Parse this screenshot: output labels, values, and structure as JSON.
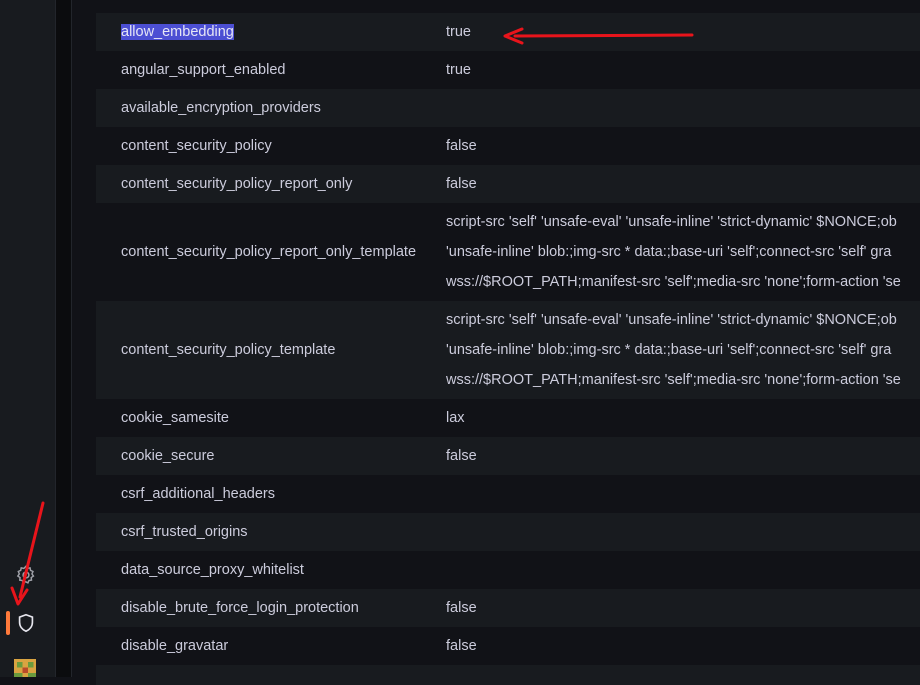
{
  "sidebar": {
    "icons": [
      "gear-icon",
      "shield-icon",
      "user-avatar"
    ],
    "active_color": "#ff7a3b"
  },
  "settings": {
    "rows": [
      {
        "key": "allow_embedding",
        "value": "true",
        "selected": true
      },
      {
        "key": "angular_support_enabled",
        "value": "true"
      },
      {
        "key": "available_encryption_providers",
        "value": ""
      },
      {
        "key": "content_security_policy",
        "value": "false"
      },
      {
        "key": "content_security_policy_report_only",
        "value": "false"
      },
      {
        "key": "content_security_policy_report_only_template",
        "lines": [
          "script-src 'self' 'unsafe-eval' 'unsafe-inline' 'strict-dynamic' $NONCE;ob",
          "'unsafe-inline' blob:;img-src * data:;base-uri 'self';connect-src 'self' gra",
          "wss://$ROOT_PATH;manifest-src 'self';media-src 'none';form-action 'se"
        ]
      },
      {
        "key": "content_security_policy_template",
        "lines": [
          "script-src 'self' 'unsafe-eval' 'unsafe-inline' 'strict-dynamic' $NONCE;ob",
          "'unsafe-inline' blob:;img-src * data:;base-uri 'self';connect-src 'self' gra",
          "wss://$ROOT_PATH;manifest-src 'self';media-src 'none';form-action 'se"
        ]
      },
      {
        "key": "cookie_samesite",
        "value": "lax"
      },
      {
        "key": "cookie_secure",
        "value": "false"
      },
      {
        "key": "csrf_additional_headers",
        "value": ""
      },
      {
        "key": "csrf_trusted_origins",
        "value": ""
      },
      {
        "key": "data_source_proxy_whitelist",
        "value": ""
      },
      {
        "key": "disable_brute_force_login_protection",
        "value": "false"
      },
      {
        "key": "disable_gravatar",
        "value": "false"
      }
    ]
  },
  "annotation_color": "#e8141b"
}
